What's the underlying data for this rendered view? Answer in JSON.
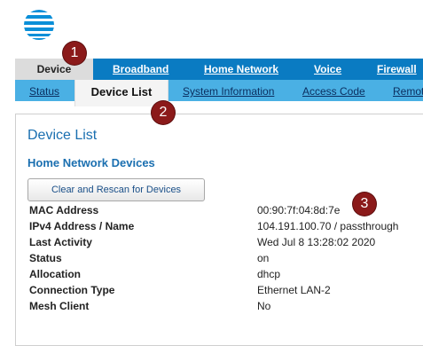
{
  "topnav": {
    "tabs": [
      "Device",
      "Broadband",
      "Home Network",
      "Voice",
      "Firewall"
    ]
  },
  "subnav": {
    "tabs": [
      "Status",
      "Device List",
      "System Information",
      "Access Code",
      "Remot"
    ]
  },
  "main": {
    "title": "Device List",
    "section_title": "Home Network Devices",
    "button_label": "Clear and Rescan for Devices",
    "details": [
      {
        "label": "MAC Address",
        "value": "00:90:7f:04:8d:7e"
      },
      {
        "label": "IPv4 Address / Name",
        "value": "104.191.100.70 / passthrough"
      },
      {
        "label": "Last Activity",
        "value": "Wed Jul 8 13:28:02 2020"
      },
      {
        "label": "Status",
        "value": "on"
      },
      {
        "label": "Allocation",
        "value": "dhcp"
      },
      {
        "label": "Connection Type",
        "value": "Ethernet LAN-2"
      },
      {
        "label": "Mesh Client",
        "value": "No"
      }
    ]
  },
  "annotations": [
    "1",
    "2",
    "3"
  ],
  "colors": {
    "topnav": "#0a7bc2",
    "subnav": "#4ab0e4",
    "accent_text": "#1a6fb0",
    "badge": "#8b1a1a"
  }
}
